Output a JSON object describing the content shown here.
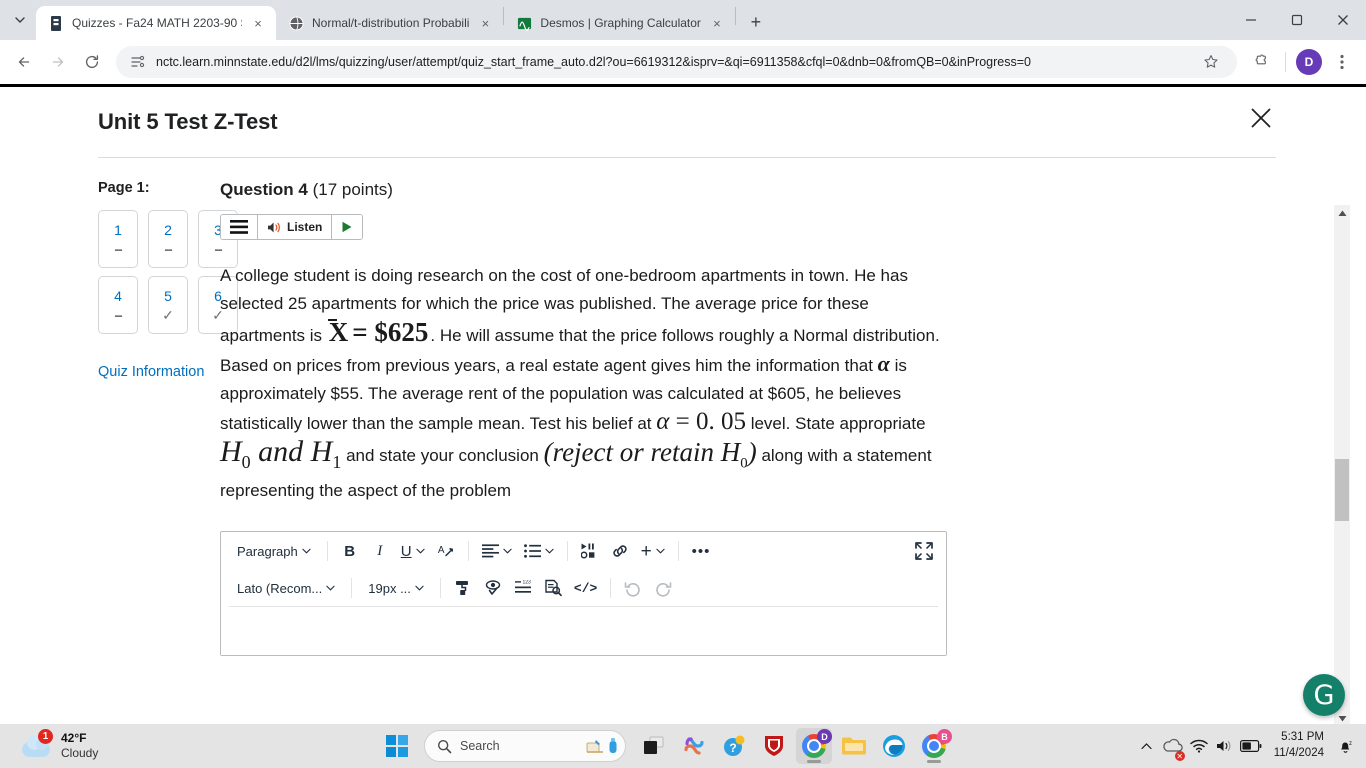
{
  "browser": {
    "tabs": [
      {
        "title": "Quizzes - Fa24 MATH 2203-90 S",
        "favicon": "d2l-icon",
        "active": true,
        "close_label": "×"
      },
      {
        "title": "Normal/t-distribution Probabili",
        "favicon": "globe-icon",
        "active": false,
        "close_label": "×"
      },
      {
        "title": "Desmos | Graphing Calculator",
        "favicon": "desmos-icon",
        "active": false,
        "close_label": "×"
      }
    ],
    "new_tab_label": "+",
    "tab_list_caret": "⌄",
    "window_controls": {
      "minimize": "—",
      "maximize": "❐",
      "close": "✕"
    },
    "nav": {
      "back": "←",
      "forward": "→",
      "reload": "↻",
      "site_info_icon": "permissions-icon",
      "url": "nctc.learn.minnstate.edu/d2l/lms/quizzing/user/attempt/quiz_start_frame_auto.d2l?ou=6619312&isprv=&qi=6911358&cfql=0&dnb=0&fromQB=0&inProgress=0",
      "bookmark_icon": "star-icon",
      "extensions_icon": "puzzle-icon",
      "profile_initial": "D",
      "menu_icon": "three-dot-menu-icon"
    }
  },
  "quiz": {
    "title": "Unit 5 Test Z-Test",
    "close_label": "✕",
    "nav": {
      "page_label": "Page 1:",
      "questions": [
        {
          "num": "1",
          "status": "--"
        },
        {
          "num": "2",
          "status": "--"
        },
        {
          "num": "3",
          "status": "--"
        },
        {
          "num": "4",
          "status": "--"
        },
        {
          "num": "5",
          "status": "✓"
        },
        {
          "num": "6",
          "status": "✓"
        }
      ],
      "quiz_information_link": "Quiz Information"
    },
    "question": {
      "label": "Question 4",
      "points": "(17 points)",
      "readspeaker": {
        "menu_icon": "hamburger-icon",
        "listen_label": "Listen",
        "speaker_icon": "speaker-icon",
        "play_icon": "play-icon"
      },
      "text": {
        "p1": "A college student is doing research on the cost of one-bedroom apartments in town. He has selected 25 apartments for which the price was published.  The average price for these apartments is ",
        "math_xbar": "X",
        "math_xbar_eq": "= $625",
        "p2": ".  He will assume that the price follows roughly a Normal distribution.  Based on prices from previous years, a real estate agent gives him the information that ",
        "math_alpha1": "α",
        "p3": " is approximately $55.  The average rent of the population was calculated at $605, he believes statistically lower than the sample mean.  Test his belief at ",
        "math_alpha_eq": "= 0. 05",
        "math_alpha_sym": "α",
        "p4": " level.  State appropriate ",
        "math_h0": "H",
        "math_h0_sub": "0",
        "math_and": "and",
        "math_h1": "H",
        "math_h1_sub": "1",
        "p5": " and state your conclusion ",
        "math_reject": "(reject or retain H",
        "math_reject_sub": "0",
        "math_reject_close": ")",
        "p6": "along with a statement representing the aspect of the problem"
      }
    },
    "editor": {
      "row1": [
        {
          "name": "block-format-select",
          "label": "Paragraph",
          "chevron": "⌄",
          "kind": "select"
        },
        {
          "name": "bold-button",
          "label": "B",
          "kind": "bold"
        },
        {
          "name": "italic-button",
          "label": "I",
          "kind": "italic"
        },
        {
          "name": "underline-button",
          "label": "U",
          "chevron": "⌄",
          "kind": "underline"
        },
        {
          "name": "clear-formatting-button",
          "label": "A",
          "kind": "format-clear"
        },
        {
          "name": "align-button",
          "chevron": "⌄",
          "kind": "align"
        },
        {
          "name": "list-button",
          "chevron": "⌄",
          "kind": "list"
        },
        {
          "name": "insert-media-button",
          "kind": "media"
        },
        {
          "name": "insert-link-button",
          "kind": "link"
        },
        {
          "name": "insert-stuff-button",
          "label": "+",
          "chevron": "⌄",
          "kind": "plus"
        },
        {
          "name": "more-options-button",
          "label": "•••",
          "kind": "ellipsis"
        },
        {
          "name": "fullscreen-button",
          "kind": "fullscreen"
        }
      ],
      "row2": [
        {
          "name": "font-family-select",
          "label": "Lato (Recom...",
          "chevron": "⌄",
          "kind": "select"
        },
        {
          "name": "font-size-select",
          "label": "19px ...",
          "chevron": "⌄",
          "kind": "select"
        },
        {
          "name": "format-painter-button",
          "kind": "painter"
        },
        {
          "name": "accessibility-check-button",
          "kind": "a11y"
        },
        {
          "name": "word-count-button",
          "kind": "wordcount"
        },
        {
          "name": "preview-button",
          "kind": "preview"
        },
        {
          "name": "html-source-button",
          "label": "</>",
          "kind": "code"
        },
        {
          "name": "undo-button",
          "kind": "undo",
          "disabled": true
        },
        {
          "name": "redo-button",
          "kind": "redo",
          "disabled": true
        }
      ]
    },
    "scrollbar": {
      "up_arrow": "▲",
      "down_arrow": "▼"
    }
  },
  "grammarly": {
    "label": "G"
  },
  "taskbar": {
    "weather": {
      "badge": "1",
      "temperature": "42°F",
      "condition": "Cloudy"
    },
    "start_label": "start-button",
    "search_placeholder": "Search",
    "apps": [
      {
        "name": "task-view",
        "kind": "taskview"
      },
      {
        "name": "copilot",
        "kind": "copilot"
      },
      {
        "name": "help",
        "kind": "help"
      },
      {
        "name": "mcafee",
        "kind": "mcafee"
      },
      {
        "name": "chrome-d2l",
        "kind": "chrome",
        "badge": "D",
        "badge_color": "#6a3ab2",
        "active": true
      },
      {
        "name": "file-explorer",
        "kind": "explorer"
      },
      {
        "name": "edge",
        "kind": "edge"
      },
      {
        "name": "chrome-b",
        "kind": "chrome",
        "badge": "B",
        "badge_color": "#e8508d"
      }
    ],
    "tray": {
      "chevron": "⌃",
      "onedrive_icon": "onedrive-error-icon",
      "wifi_icon": "wifi-icon",
      "volume_icon": "volume-icon",
      "battery_icon": "battery-icon",
      "time": "5:31 PM",
      "date": "11/4/2024",
      "notification_icon": "notification-bell-icon"
    }
  },
  "colors": {
    "tab_bar": "#dee1e6",
    "link": "#006fbf",
    "accent_purple": "#673ab7",
    "grammarly_green": "#15806a",
    "badge_red": "#e3261e"
  }
}
